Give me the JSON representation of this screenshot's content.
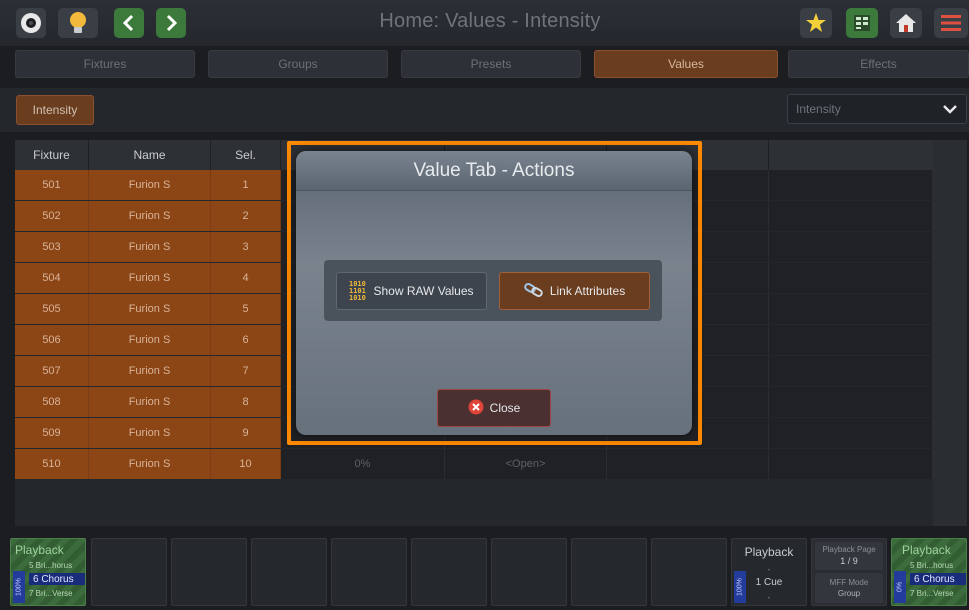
{
  "header": {
    "title": "Home: Values - Intensity",
    "icons": [
      "eye-icon",
      "lightbulb-icon",
      "back-arrow-icon",
      "forward-arrow-icon",
      "magic-star-icon",
      "grid-view-icon",
      "home-icon",
      "menu-icon"
    ]
  },
  "tabs": [
    {
      "label": "Fixtures",
      "active": false
    },
    {
      "label": "Groups",
      "active": false
    },
    {
      "label": "Presets",
      "active": false
    },
    {
      "label": "Values",
      "active": true
    },
    {
      "label": "Effects",
      "active": false
    }
  ],
  "toolbar": {
    "attribute_button": "Intensity",
    "attribute_select": "Intensity"
  },
  "table": {
    "columns": [
      "Fixture",
      "Name",
      "Sel."
    ],
    "rows": [
      {
        "fixture": "501",
        "name": "Furion S",
        "sel": "1"
      },
      {
        "fixture": "502",
        "name": "Furion S",
        "sel": "2"
      },
      {
        "fixture": "503",
        "name": "Furion S",
        "sel": "3"
      },
      {
        "fixture": "504",
        "name": "Furion S",
        "sel": "4"
      },
      {
        "fixture": "505",
        "name": "Furion S",
        "sel": "5"
      },
      {
        "fixture": "506",
        "name": "Furion S",
        "sel": "6"
      },
      {
        "fixture": "507",
        "name": "Furion S",
        "sel": "7"
      },
      {
        "fixture": "508",
        "name": "Furion S",
        "sel": "8"
      },
      {
        "fixture": "509",
        "name": "Furion S",
        "sel": "9"
      },
      {
        "fixture": "510",
        "name": "Furion S",
        "sel": "10",
        "value": "0%",
        "status": "<Open>"
      }
    ]
  },
  "dialog": {
    "title": "Value Tab - Actions",
    "show_raw_label": "Show RAW Values",
    "link_label": "Link Attributes",
    "close_label": "Close"
  },
  "playback": {
    "left": {
      "label": "Playback",
      "prev": "5 Bri...horus",
      "current": "6 Chorus",
      "next": "7 Bri...Verse",
      "level": "100%"
    },
    "center": {
      "label": "Playback",
      "dash_top": "-",
      "cue": "1 Cue",
      "dash_bottom": "-",
      "level": "100%"
    },
    "page": {
      "label": "Playback Page",
      "value": "1 / 9",
      "mode_label": "MFF Mode",
      "mode_value": "Group"
    },
    "right": {
      "label": "Playback",
      "prev": "5 Bri...horus",
      "current": "6 Chorus",
      "next": "7 Bri...Verse",
      "level": "0%"
    }
  }
}
